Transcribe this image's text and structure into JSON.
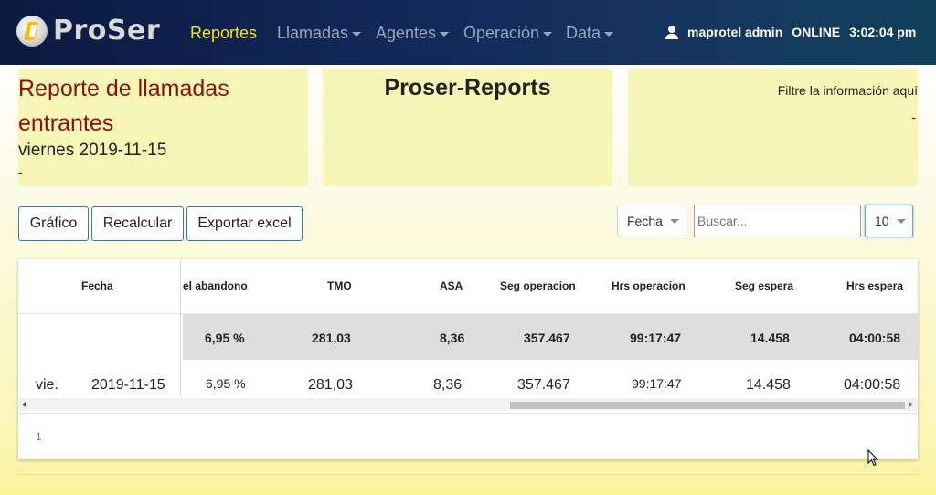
{
  "navbar": {
    "logo_text": "ProSer",
    "menu": [
      {
        "label": "Reportes"
      },
      {
        "label": "Llamadas"
      },
      {
        "label": "Agentes"
      },
      {
        "label": "Operación"
      },
      {
        "label": "Data"
      }
    ],
    "user_name": "maprotel admin",
    "status": "ONLINE",
    "time": "3:02:04 pm"
  },
  "panels": {
    "report_title": "Reporte de llamadas entrantes",
    "report_date": "viernes 2019-11-15",
    "report_dash": "-",
    "center_title": "Proser-Reports",
    "filter_text": "Filtre la información aquí",
    "filter_dash": "-"
  },
  "toolbar": {
    "grafico": "Gráfico",
    "recalcular": "Recalcular",
    "exportar": "Exportar excel",
    "column_select": "Fecha",
    "search_placeholder": "Buscar...",
    "page_length": "10"
  },
  "table": {
    "headers": [
      "Fecha",
      "el abandono",
      "TMO",
      "ASA",
      "Seg operacion",
      "Hrs operacion",
      "Seg espera",
      "Hrs espera"
    ],
    "totals": [
      "6,95 %",
      "281,03",
      "8,36",
      "357.467",
      "99:17:47",
      "14.458",
      "04:00:58"
    ],
    "rows": [
      {
        "day": "vie.",
        "date": "2019-11-15",
        "cells": [
          "6,95 %",
          "281,03",
          "8,36",
          "357.467",
          "99:17:47",
          "14.458",
          "04:00:58"
        ]
      }
    ]
  },
  "pagination": {
    "page": "1"
  },
  "colors": {
    "accent": "#f5e21c",
    "nav_bg": "#12295a",
    "panel_bg": "#f7f6b7",
    "title_red": "#8b1010",
    "button_border": "#2a7bc0"
  }
}
